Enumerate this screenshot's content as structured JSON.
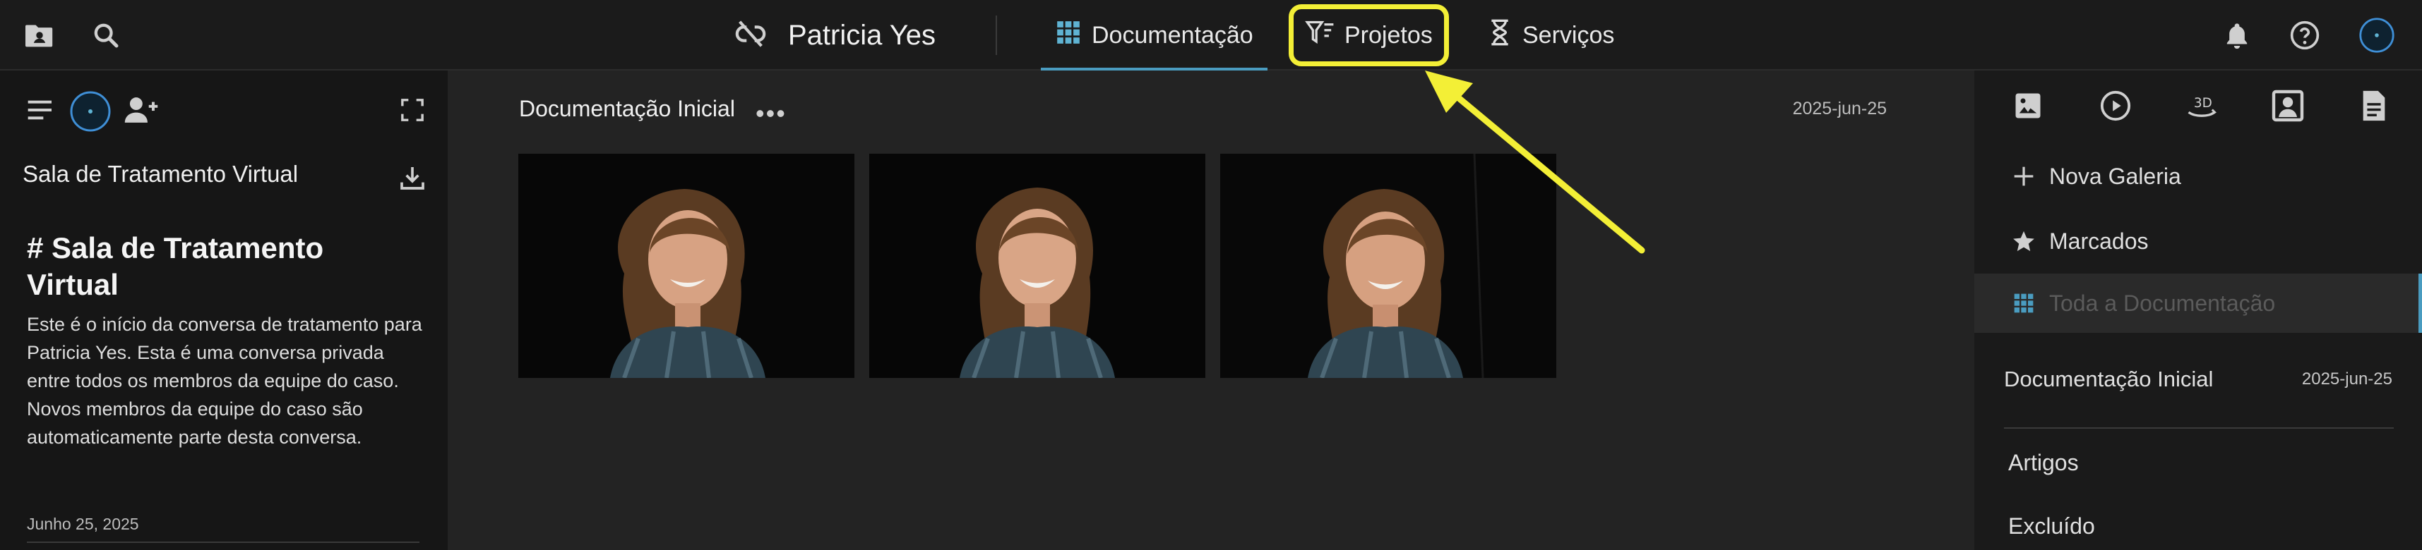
{
  "topbar": {
    "patient_name": "Patricia Yes",
    "tabs": [
      {
        "label": "Documentação",
        "icon": "grid-icon"
      },
      {
        "label": "Projetos",
        "icon": "filter-tooth-icon"
      },
      {
        "label": "Serviços",
        "icon": "hourglass-icon"
      }
    ],
    "active_tab": "Documentação",
    "highlighted_tab": "Projetos"
  },
  "left_panel": {
    "room_title": "Sala de Tratamento Virtual",
    "markdown_title": "# Sala de Tratamento Virtual",
    "markdown_body": "Este é o início da conversa de tratamento para Patricia Yes. Esta é uma conversa privada entre todos os membros da equipe do caso. Novos membros da equipe do caso são automaticamente parte desta conversa.",
    "date_separator": "Junho 25, 2025"
  },
  "main": {
    "gallery_title": "Documentação Inicial",
    "more_label": "•••",
    "gallery_date": "2025-jun-25",
    "photo_count": 3
  },
  "right_panel": {
    "items": [
      {
        "label": "Nova Galeria",
        "icon": "plus-icon"
      },
      {
        "label": "Marcados",
        "icon": "star-icon"
      },
      {
        "label": "Toda a Documentação",
        "icon": "grid-icon"
      }
    ],
    "selected_item": "Toda a Documentação",
    "doc_entry": {
      "label": "Documentação Inicial",
      "date": "2025-jun-25"
    },
    "links": [
      "Artigos",
      "Excluído"
    ]
  },
  "colors": {
    "accent": "#4a9cc0",
    "highlight": "#f3ef36",
    "topbar_bg": "#1b1b1b",
    "panel_bg": "#161616",
    "main_bg": "#232323"
  }
}
